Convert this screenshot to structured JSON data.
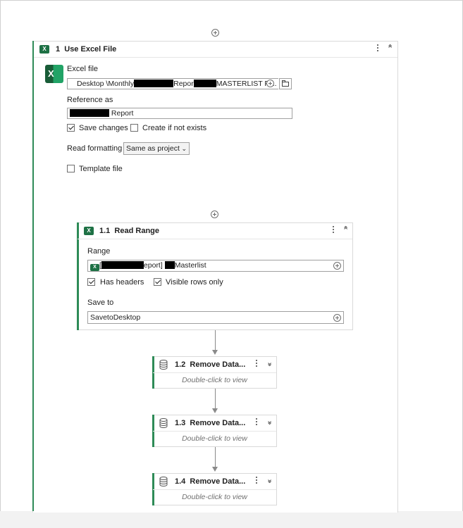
{
  "use_excel_file": {
    "step": "1",
    "title": "Use Excel File",
    "excel_file_label": "Excel file",
    "excel_file_value_prefix": "Desktop  \\Monthly",
    "excel_file_value_mid": "Repor",
    "excel_file_value_suffix": "MASTERLIST F'...",
    "reference_as_label": "Reference as",
    "reference_as_value": " Report",
    "save_changes_label": "Save changes",
    "save_changes_checked": true,
    "create_if_not_exists_label": "Create if not exists",
    "create_if_not_exists_checked": false,
    "read_formatting_label": "Read formatting",
    "read_formatting_value": "Same as project",
    "template_file_label": "Template file",
    "template_file_checked": false
  },
  "read_range": {
    "step": "1.1",
    "title": "Read Range",
    "range_label": "Range",
    "range_value_prefix": "[",
    "range_value_mid": "eport] ",
    "range_value_suffix": "Masterlist",
    "has_headers_label": "Has headers",
    "has_headers_checked": true,
    "visible_rows_only_label": "Visible rows only",
    "visible_rows_only_checked": true,
    "save_to_label": "Save to",
    "save_to_value": "SavetoDesktop"
  },
  "collapsed_activities": [
    {
      "step": "1.2",
      "title": "Remove Data...",
      "hint": "Double-click to view"
    },
    {
      "step": "1.3",
      "title": "Remove Data...",
      "hint": "Double-click to view"
    },
    {
      "step": "1.4",
      "title": "Remove Data...",
      "hint": "Double-click to view"
    }
  ],
  "colors": {
    "accent": "#2e8b57",
    "excel_green": "#1e7145"
  },
  "icons": [
    "add-icon",
    "excel-icon",
    "kebab-menu-icon",
    "collapse-icon",
    "expand-icon",
    "folder-icon",
    "database-icon",
    "checkbox-icon",
    "dropdown-icon"
  ]
}
